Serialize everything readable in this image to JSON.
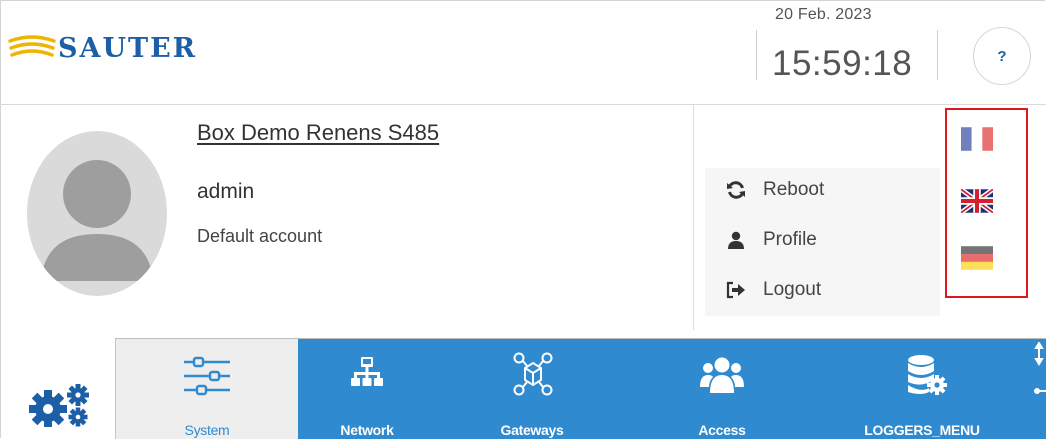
{
  "header": {
    "logo_text": "SAUTER",
    "date": "20 Feb. 2023",
    "time": "15:59:18",
    "help_label": "?"
  },
  "profile": {
    "device_name": "Box Demo Renens S485",
    "username": "admin",
    "account_type": "Default account"
  },
  "actions": [
    {
      "label": "Reboot",
      "icon": "reboot-icon"
    },
    {
      "label": "Profile",
      "icon": "user-icon"
    },
    {
      "label": "Logout",
      "icon": "logout-icon"
    }
  ],
  "languages": [
    {
      "name": "french-flag",
      "colors": [
        "#3a4fa3",
        "#ffffff",
        "#e23b3b"
      ]
    },
    {
      "name": "uk-flag",
      "colors": [
        "#1f2f7a",
        "#ffffff",
        "#d3202f"
      ]
    },
    {
      "name": "german-flag",
      "colors": [
        "#2a2a2a",
        "#dd1f1f",
        "#ffcc00"
      ]
    }
  ],
  "nav": {
    "tabs": [
      {
        "label": "System",
        "icon": "sliders-icon",
        "active": true
      },
      {
        "label": "Network",
        "icon": "network-icon",
        "active": false
      },
      {
        "label": "Gateways",
        "icon": "gateway-icon",
        "active": false
      },
      {
        "label": "Access",
        "icon": "users-icon",
        "active": false
      },
      {
        "label": "LOGGERS_MENU",
        "icon": "database-gear-icon",
        "active": false
      }
    ]
  },
  "colors": {
    "brand_blue": "#1d5fa6",
    "nav_blue": "#2f8ad0",
    "highlight_red": "#e0171e"
  }
}
